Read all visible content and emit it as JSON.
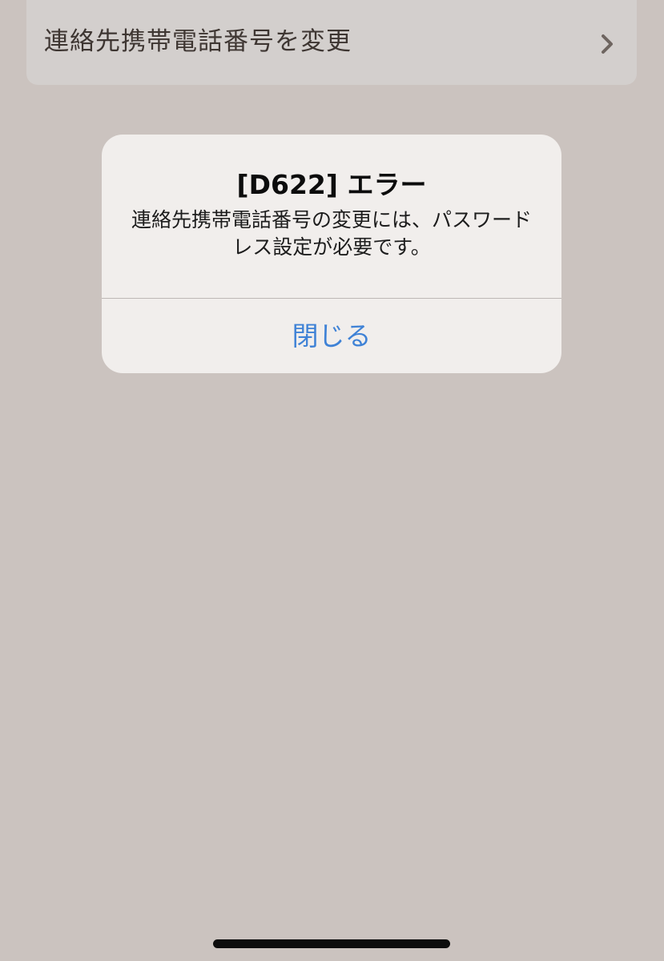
{
  "settings_row": {
    "label": "連絡先携帯電話番号を変更",
    "icon": "chevron-right-icon"
  },
  "alert": {
    "title": "[D622] エラー",
    "message": "連絡先携帯電話番号の変更には、パスワードレス設定が必要です。",
    "close_label": "閉じる"
  },
  "colors": {
    "background": "#cbc3bf",
    "row_background": "#d3cfcd",
    "alert_background": "#f1eeec",
    "button_text": "#3f82d6"
  }
}
